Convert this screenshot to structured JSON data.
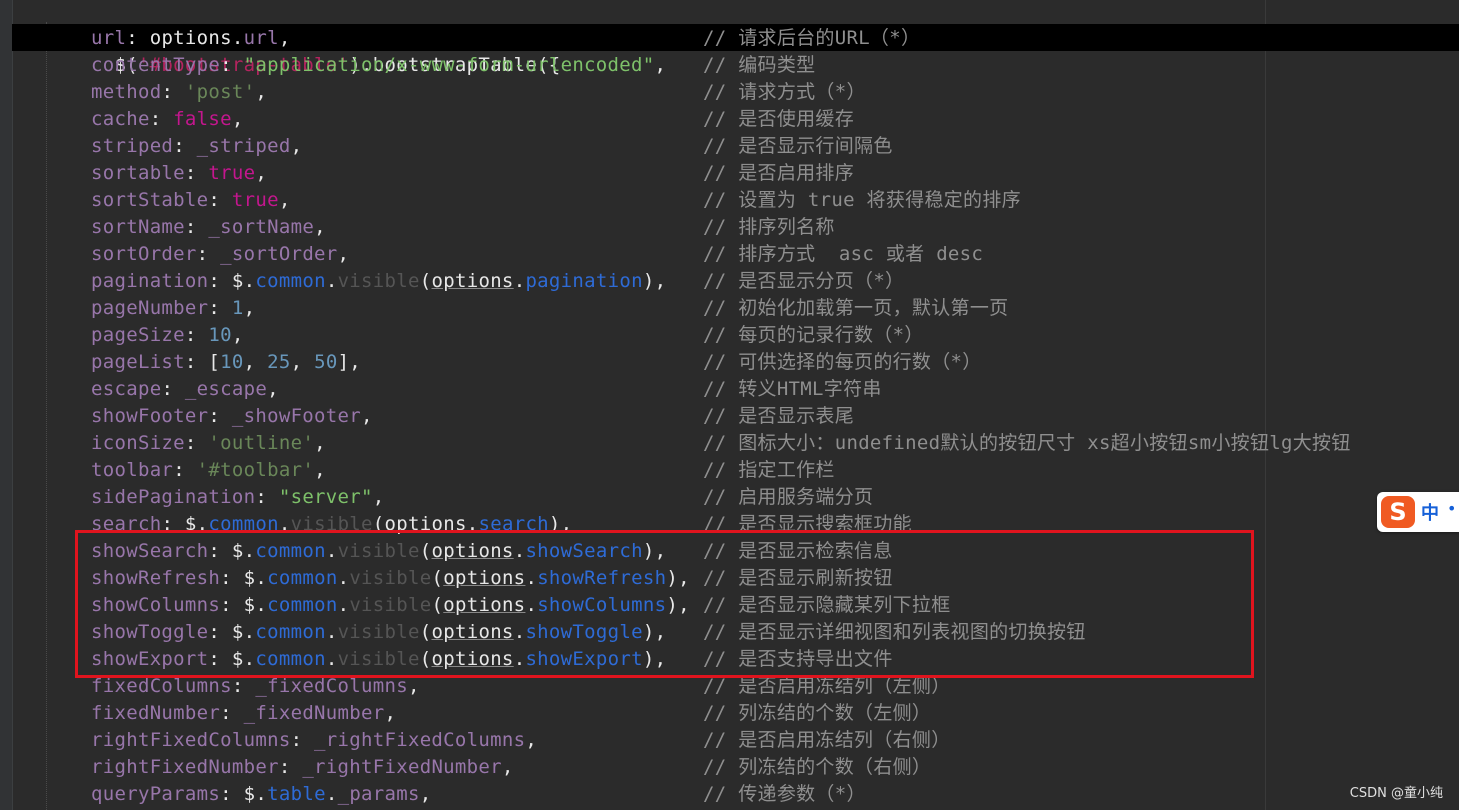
{
  "header": {
    "dollar": "$(",
    "selector": "'#bootstrap-table'",
    "rest": ").bootstrapTable({"
  },
  "lines": [
    {
      "tokens": [
        [
          "k",
          "url"
        ],
        [
          "w",
          ": "
        ],
        [
          "w",
          "options"
        ],
        [
          "w",
          "."
        ],
        [
          "k",
          "url"
        ],
        [
          "w",
          ","
        ]
      ],
      "comment": "// 请求后台的URL（*）"
    },
    {
      "tokens": [
        [
          "k",
          "contentType"
        ],
        [
          "w",
          ": "
        ],
        [
          "sd",
          "\"application/x-www-form-urlencoded\""
        ],
        [
          "w",
          ","
        ]
      ],
      "comment": "// 编码类型"
    },
    {
      "tokens": [
        [
          "k",
          "method"
        ],
        [
          "w",
          ": "
        ],
        [
          "s",
          "'post'"
        ],
        [
          "w",
          ","
        ]
      ],
      "comment": "// 请求方式（*）"
    },
    {
      "tokens": [
        [
          "k",
          "cache"
        ],
        [
          "w",
          ": "
        ],
        [
          "kw",
          "false"
        ],
        [
          "w",
          ","
        ]
      ],
      "comment": "// 是否使用缓存"
    },
    {
      "tokens": [
        [
          "k",
          "striped"
        ],
        [
          "w",
          ": "
        ],
        [
          "k",
          "_striped"
        ],
        [
          "w",
          ","
        ]
      ],
      "comment": "// 是否显示行间隔色"
    },
    {
      "tokens": [
        [
          "k",
          "sortable"
        ],
        [
          "w",
          ": "
        ],
        [
          "kw",
          "true"
        ],
        [
          "w",
          ","
        ]
      ],
      "comment": "// 是否启用排序"
    },
    {
      "tokens": [
        [
          "k",
          "sortStable"
        ],
        [
          "w",
          ": "
        ],
        [
          "kw",
          "true"
        ],
        [
          "w",
          ","
        ]
      ],
      "comment": "// 设置为 true 将获得稳定的排序"
    },
    {
      "tokens": [
        [
          "k",
          "sortName"
        ],
        [
          "w",
          ": "
        ],
        [
          "k",
          "_sortName"
        ],
        [
          "w",
          ","
        ]
      ],
      "comment": "// 排序列名称"
    },
    {
      "tokens": [
        [
          "k",
          "sortOrder"
        ],
        [
          "w",
          ": "
        ],
        [
          "k",
          "_sortOrder"
        ],
        [
          "w",
          ","
        ]
      ],
      "comment": "// 排序方式  asc 或者 desc"
    },
    {
      "tokens": [
        [
          "k",
          "pagination"
        ],
        [
          "w",
          ": "
        ],
        [
          "w",
          "$"
        ],
        [
          "w",
          "."
        ],
        [
          "prop",
          "common"
        ],
        [
          "w",
          "."
        ],
        [
          "fn",
          "visible"
        ],
        [
          "w",
          "("
        ],
        [
          "ul",
          "options"
        ],
        [
          "w",
          "."
        ],
        [
          "prop",
          "pagination"
        ],
        [
          "w",
          "),"
        ]
      ],
      "comment": "// 是否显示分页（*）"
    },
    {
      "tokens": [
        [
          "k",
          "pageNumber"
        ],
        [
          "w",
          ": "
        ],
        [
          "num",
          "1"
        ],
        [
          "w",
          ","
        ]
      ],
      "comment": "// 初始化加载第一页，默认第一页"
    },
    {
      "tokens": [
        [
          "k",
          "pageSize"
        ],
        [
          "w",
          ": "
        ],
        [
          "num",
          "10"
        ],
        [
          "w",
          ","
        ]
      ],
      "comment": "// 每页的记录行数（*）"
    },
    {
      "tokens": [
        [
          "k",
          "pageList"
        ],
        [
          "w",
          ": ["
        ],
        [
          "num",
          "10"
        ],
        [
          "w",
          ", "
        ],
        [
          "num",
          "25"
        ],
        [
          "w",
          ", "
        ],
        [
          "num",
          "50"
        ],
        [
          "w",
          "],"
        ]
      ],
      "comment": "// 可供选择的每页的行数（*）"
    },
    {
      "tokens": [
        [
          "k",
          "escape"
        ],
        [
          "w",
          ": "
        ],
        [
          "k",
          "_escape"
        ],
        [
          "w",
          ","
        ]
      ],
      "comment": "// 转义HTML字符串"
    },
    {
      "tokens": [
        [
          "k",
          "showFooter"
        ],
        [
          "w",
          ": "
        ],
        [
          "k",
          "_showFooter"
        ],
        [
          "w",
          ","
        ]
      ],
      "comment": "// 是否显示表尾"
    },
    {
      "tokens": [
        [
          "k",
          "iconSize"
        ],
        [
          "w",
          ": "
        ],
        [
          "s",
          "'outline'"
        ],
        [
          "w",
          ","
        ]
      ],
      "comment": "// 图标大小：undefined默认的按钮尺寸 xs超小按钮sm小按钮lg大按钮"
    },
    {
      "tokens": [
        [
          "k",
          "toolbar"
        ],
        [
          "w",
          ": "
        ],
        [
          "s",
          "'#toolbar'"
        ],
        [
          "w",
          ","
        ]
      ],
      "comment": "// 指定工作栏"
    },
    {
      "tokens": [
        [
          "k",
          "sidePagination"
        ],
        [
          "w",
          ": "
        ],
        [
          "sd",
          "\"server\""
        ],
        [
          "w",
          ","
        ]
      ],
      "comment": "// 启用服务端分页"
    },
    {
      "tokens": [
        [
          "k",
          "search"
        ],
        [
          "w",
          ": "
        ],
        [
          "w",
          "$"
        ],
        [
          "w",
          "."
        ],
        [
          "prop",
          "common"
        ],
        [
          "w",
          "."
        ],
        [
          "fn",
          "visible"
        ],
        [
          "w",
          "("
        ],
        [
          "ul",
          "options"
        ],
        [
          "w",
          "."
        ],
        [
          "prop",
          "search"
        ],
        [
          "w",
          "),"
        ]
      ],
      "comment": "// 是否显示搜索框功能"
    },
    {
      "tokens": [
        [
          "k",
          "showSearch"
        ],
        [
          "w",
          ": "
        ],
        [
          "w",
          "$"
        ],
        [
          "w",
          "."
        ],
        [
          "prop",
          "common"
        ],
        [
          "w",
          "."
        ],
        [
          "fn",
          "visible"
        ],
        [
          "w",
          "("
        ],
        [
          "ul",
          "options"
        ],
        [
          "w",
          "."
        ],
        [
          "prop",
          "showSearch"
        ],
        [
          "w",
          "),"
        ]
      ],
      "comment": "// 是否显示检索信息"
    },
    {
      "tokens": [
        [
          "k",
          "showRefresh"
        ],
        [
          "w",
          ": "
        ],
        [
          "w",
          "$"
        ],
        [
          "w",
          "."
        ],
        [
          "prop",
          "common"
        ],
        [
          "w",
          "."
        ],
        [
          "fn",
          "visible"
        ],
        [
          "w",
          "("
        ],
        [
          "ul",
          "options"
        ],
        [
          "w",
          "."
        ],
        [
          "prop",
          "showRefresh"
        ],
        [
          "w",
          "),"
        ]
      ],
      "comment": "// 是否显示刷新按钮"
    },
    {
      "tokens": [
        [
          "k",
          "showColumns"
        ],
        [
          "w",
          ": "
        ],
        [
          "w",
          "$"
        ],
        [
          "w",
          "."
        ],
        [
          "prop",
          "common"
        ],
        [
          "w",
          "."
        ],
        [
          "fn",
          "visible"
        ],
        [
          "w",
          "("
        ],
        [
          "ul",
          "options"
        ],
        [
          "w",
          "."
        ],
        [
          "prop",
          "showColumns"
        ],
        [
          "w",
          "),"
        ]
      ],
      "comment": "// 是否显示隐藏某列下拉框"
    },
    {
      "tokens": [
        [
          "k",
          "showToggle"
        ],
        [
          "w",
          ": "
        ],
        [
          "w",
          "$"
        ],
        [
          "w",
          "."
        ],
        [
          "prop",
          "common"
        ],
        [
          "w",
          "."
        ],
        [
          "fn",
          "visible"
        ],
        [
          "w",
          "("
        ],
        [
          "ul",
          "options"
        ],
        [
          "w",
          "."
        ],
        [
          "prop",
          "showToggle"
        ],
        [
          "w",
          "),"
        ]
      ],
      "comment": "// 是否显示详细视图和列表视图的切换按钮"
    },
    {
      "tokens": [
        [
          "k",
          "showExport"
        ],
        [
          "w",
          ": "
        ],
        [
          "w",
          "$"
        ],
        [
          "w",
          "."
        ],
        [
          "prop",
          "common"
        ],
        [
          "w",
          "."
        ],
        [
          "fn",
          "visible"
        ],
        [
          "w",
          "("
        ],
        [
          "ul",
          "options"
        ],
        [
          "w",
          "."
        ],
        [
          "prop",
          "showExport"
        ],
        [
          "w",
          "),"
        ]
      ],
      "comment": "// 是否支持导出文件"
    },
    {
      "tokens": [
        [
          "k",
          "fixedColumns"
        ],
        [
          "w",
          ": "
        ],
        [
          "k",
          "_fixedColumns"
        ],
        [
          "w",
          ","
        ]
      ],
      "comment": "// 是否启用冻结列（左侧）"
    },
    {
      "tokens": [
        [
          "k",
          "fixedNumber"
        ],
        [
          "w",
          ": "
        ],
        [
          "k",
          "_fixedNumber"
        ],
        [
          "w",
          ","
        ]
      ],
      "comment": "// 列冻结的个数（左侧）"
    },
    {
      "tokens": [
        [
          "k",
          "rightFixedColumns"
        ],
        [
          "w",
          ": "
        ],
        [
          "k",
          "_rightFixedColumns"
        ],
        [
          "w",
          ","
        ]
      ],
      "comment": "// 是否启用冻结列（右侧）"
    },
    {
      "tokens": [
        [
          "k",
          "rightFixedNumber"
        ],
        [
          "w",
          ": "
        ],
        [
          "k",
          "_rightFixedNumber"
        ],
        [
          "w",
          ","
        ]
      ],
      "comment": "// 列冻结的个数（右侧）"
    },
    {
      "tokens": [
        [
          "k",
          "queryParams"
        ],
        [
          "w",
          ": "
        ],
        [
          "w",
          "$"
        ],
        [
          "w",
          "."
        ],
        [
          "prop",
          "table"
        ],
        [
          "w",
          "."
        ],
        [
          "k",
          "_params"
        ],
        [
          "w",
          ","
        ]
      ],
      "comment": "// 传递参数（*）"
    }
  ],
  "ime": {
    "logo": "S",
    "mode": "中",
    "extra": "•"
  },
  "watermark": "CSDN @童小纯"
}
